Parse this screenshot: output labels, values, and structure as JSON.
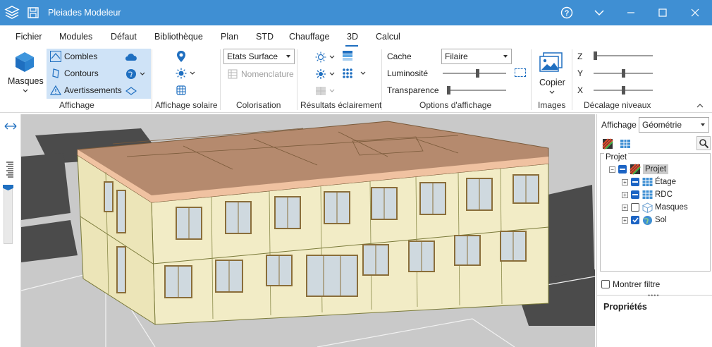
{
  "window": {
    "title": "Pleiades Modeleur"
  },
  "menu": {
    "items": [
      "Fichier",
      "Modules",
      "Défaut",
      "Bibliothèque",
      "Plan",
      "STD",
      "Chauffage",
      "3D",
      "Calcul"
    ],
    "active": "3D"
  },
  "ribbon": {
    "masques_label": "Masques",
    "affichage": {
      "combles": "Combles",
      "contours": "Contours",
      "avertissements": "Avertissements",
      "group_label": "Affichage"
    },
    "affichage_solaire": {
      "group_label": "Affichage solaire"
    },
    "colorisation": {
      "dropdown_value": "Etats Surface",
      "nomenclature": "Nomenclature",
      "group_label": "Colorisation"
    },
    "resultats": {
      "group_label": "Résultats éclairement"
    },
    "options": {
      "cache_label": "Cache",
      "cache_value": "Filaire",
      "luminosite_label": "Luminosité",
      "transparence_label": "Transparence",
      "group_label": "Options d'affichage",
      "luminosite_level": 0.55,
      "transparence_level": 0.0
    },
    "images": {
      "copier": "Copier",
      "group_label": "Images"
    },
    "decalage": {
      "z_label": "Z",
      "y_label": "Y",
      "x_label": "X",
      "group_label": "Décalage niveaux",
      "z_level": 0.0,
      "y_level": 0.5,
      "x_level": 0.5
    }
  },
  "panel": {
    "affichage_label": "Affichage",
    "affichage_value": "Géométrie",
    "projet_header": "Projet",
    "tree": [
      {
        "label": "Projet",
        "state": "indeterminate"
      },
      {
        "label": "Étage",
        "state": "indeterminate"
      },
      {
        "label": "RDC",
        "state": "indeterminate"
      },
      {
        "label": "Masques",
        "state": "unchecked"
      },
      {
        "label": "Sol",
        "state": "checked"
      }
    ],
    "filter_label": "Montrer filtre",
    "properties_title": "Propriétés"
  },
  "colors": {
    "titlebar": "#3f8fd3",
    "accent": "#1c64c4",
    "selection": "#cfe3f7",
    "wall": "#f2ecc6",
    "roof": "#b58a6e",
    "ground": "#c9c9c9"
  }
}
